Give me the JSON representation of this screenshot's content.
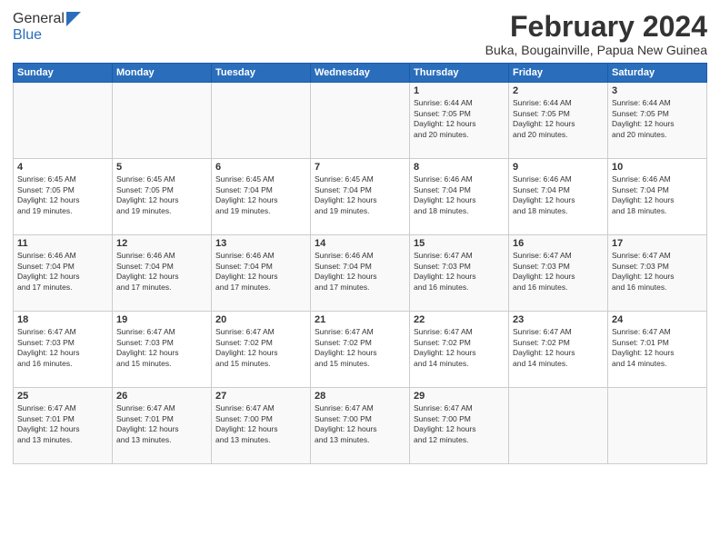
{
  "logo": {
    "general": "General",
    "blue": "Blue"
  },
  "title": "February 2024",
  "location": "Buka, Bougainville, Papua New Guinea",
  "days_header": [
    "Sunday",
    "Monday",
    "Tuesday",
    "Wednesday",
    "Thursday",
    "Friday",
    "Saturday"
  ],
  "weeks": [
    {
      "cells": [
        {
          "day": "",
          "text": ""
        },
        {
          "day": "",
          "text": ""
        },
        {
          "day": "",
          "text": ""
        },
        {
          "day": "",
          "text": ""
        },
        {
          "day": "1",
          "text": "Sunrise: 6:44 AM\nSunset: 7:05 PM\nDaylight: 12 hours\nand 20 minutes."
        },
        {
          "day": "2",
          "text": "Sunrise: 6:44 AM\nSunset: 7:05 PM\nDaylight: 12 hours\nand 20 minutes."
        },
        {
          "day": "3",
          "text": "Sunrise: 6:44 AM\nSunset: 7:05 PM\nDaylight: 12 hours\nand 20 minutes."
        }
      ]
    },
    {
      "cells": [
        {
          "day": "4",
          "text": "Sunrise: 6:45 AM\nSunset: 7:05 PM\nDaylight: 12 hours\nand 19 minutes."
        },
        {
          "day": "5",
          "text": "Sunrise: 6:45 AM\nSunset: 7:05 PM\nDaylight: 12 hours\nand 19 minutes."
        },
        {
          "day": "6",
          "text": "Sunrise: 6:45 AM\nSunset: 7:04 PM\nDaylight: 12 hours\nand 19 minutes."
        },
        {
          "day": "7",
          "text": "Sunrise: 6:45 AM\nSunset: 7:04 PM\nDaylight: 12 hours\nand 19 minutes."
        },
        {
          "day": "8",
          "text": "Sunrise: 6:46 AM\nSunset: 7:04 PM\nDaylight: 12 hours\nand 18 minutes."
        },
        {
          "day": "9",
          "text": "Sunrise: 6:46 AM\nSunset: 7:04 PM\nDaylight: 12 hours\nand 18 minutes."
        },
        {
          "day": "10",
          "text": "Sunrise: 6:46 AM\nSunset: 7:04 PM\nDaylight: 12 hours\nand 18 minutes."
        }
      ]
    },
    {
      "cells": [
        {
          "day": "11",
          "text": "Sunrise: 6:46 AM\nSunset: 7:04 PM\nDaylight: 12 hours\nand 17 minutes."
        },
        {
          "day": "12",
          "text": "Sunrise: 6:46 AM\nSunset: 7:04 PM\nDaylight: 12 hours\nand 17 minutes."
        },
        {
          "day": "13",
          "text": "Sunrise: 6:46 AM\nSunset: 7:04 PM\nDaylight: 12 hours\nand 17 minutes."
        },
        {
          "day": "14",
          "text": "Sunrise: 6:46 AM\nSunset: 7:04 PM\nDaylight: 12 hours\nand 17 minutes."
        },
        {
          "day": "15",
          "text": "Sunrise: 6:47 AM\nSunset: 7:03 PM\nDaylight: 12 hours\nand 16 minutes."
        },
        {
          "day": "16",
          "text": "Sunrise: 6:47 AM\nSunset: 7:03 PM\nDaylight: 12 hours\nand 16 minutes."
        },
        {
          "day": "17",
          "text": "Sunrise: 6:47 AM\nSunset: 7:03 PM\nDaylight: 12 hours\nand 16 minutes."
        }
      ]
    },
    {
      "cells": [
        {
          "day": "18",
          "text": "Sunrise: 6:47 AM\nSunset: 7:03 PM\nDaylight: 12 hours\nand 16 minutes."
        },
        {
          "day": "19",
          "text": "Sunrise: 6:47 AM\nSunset: 7:03 PM\nDaylight: 12 hours\nand 15 minutes."
        },
        {
          "day": "20",
          "text": "Sunrise: 6:47 AM\nSunset: 7:02 PM\nDaylight: 12 hours\nand 15 minutes."
        },
        {
          "day": "21",
          "text": "Sunrise: 6:47 AM\nSunset: 7:02 PM\nDaylight: 12 hours\nand 15 minutes."
        },
        {
          "day": "22",
          "text": "Sunrise: 6:47 AM\nSunset: 7:02 PM\nDaylight: 12 hours\nand 14 minutes."
        },
        {
          "day": "23",
          "text": "Sunrise: 6:47 AM\nSunset: 7:02 PM\nDaylight: 12 hours\nand 14 minutes."
        },
        {
          "day": "24",
          "text": "Sunrise: 6:47 AM\nSunset: 7:01 PM\nDaylight: 12 hours\nand 14 minutes."
        }
      ]
    },
    {
      "cells": [
        {
          "day": "25",
          "text": "Sunrise: 6:47 AM\nSunset: 7:01 PM\nDaylight: 12 hours\nand 13 minutes."
        },
        {
          "day": "26",
          "text": "Sunrise: 6:47 AM\nSunset: 7:01 PM\nDaylight: 12 hours\nand 13 minutes."
        },
        {
          "day": "27",
          "text": "Sunrise: 6:47 AM\nSunset: 7:00 PM\nDaylight: 12 hours\nand 13 minutes."
        },
        {
          "day": "28",
          "text": "Sunrise: 6:47 AM\nSunset: 7:00 PM\nDaylight: 12 hours\nand 13 minutes."
        },
        {
          "day": "29",
          "text": "Sunrise: 6:47 AM\nSunset: 7:00 PM\nDaylight: 12 hours\nand 12 minutes."
        },
        {
          "day": "",
          "text": ""
        },
        {
          "day": "",
          "text": ""
        }
      ]
    }
  ]
}
